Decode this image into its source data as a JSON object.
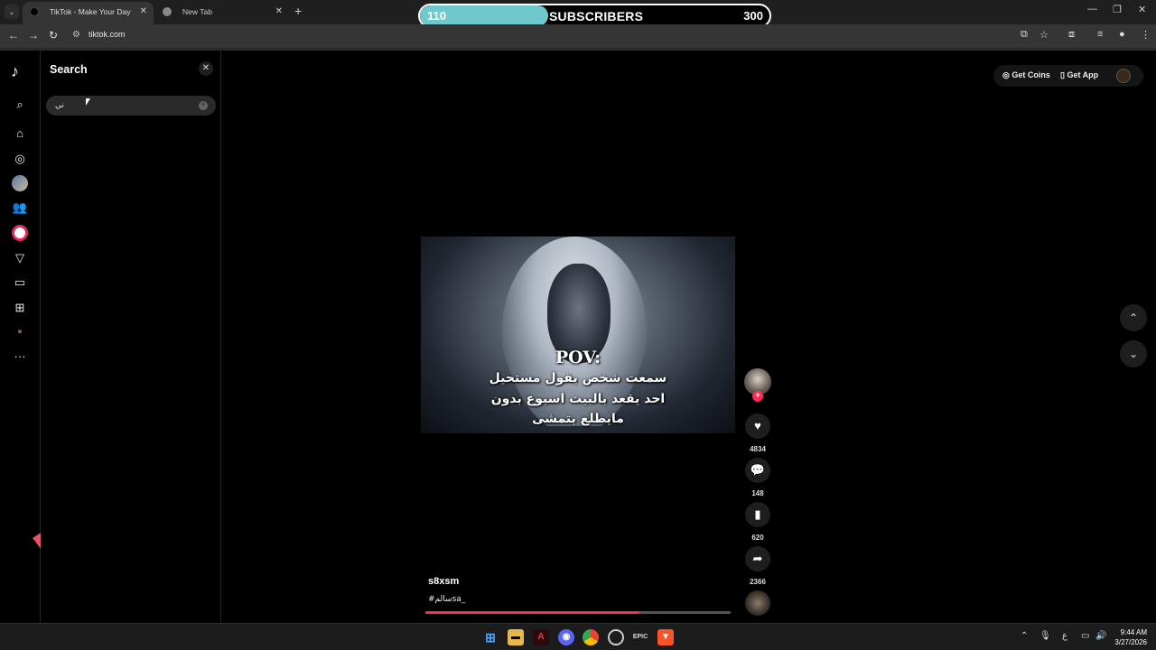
{
  "browser": {
    "tabs": [
      {
        "title": "TikTok - Make Your Day",
        "active": true
      },
      {
        "title": "New Tab",
        "active": false
      }
    ],
    "url": "tiktok.com"
  },
  "overlay": {
    "current": "110",
    "label": "SUBSCRIBERS",
    "goal": "300",
    "progress_fraction": 0.367,
    "color": "#6fc9cc"
  },
  "search_panel": {
    "title": "Search",
    "input_value": "ني"
  },
  "top_actions": {
    "get_coins": "Get Coins",
    "get_app": "Get App"
  },
  "video": {
    "pov": "POV:",
    "caption_lines": [
      "سمعت شخص يقول مستحيل",
      "احد يقعد بالبيت اسبوع بدون",
      "مايطلع يتمشى"
    ],
    "author": "s8xsm",
    "hashtag": "#سالمsa_",
    "progress_fraction": 0.7
  },
  "stats": {
    "likes": "4834",
    "comments": "148",
    "saves": "620",
    "shares": "2366"
  },
  "taskbar": {
    "time": "9:44 AM",
    "date": "3/27/2026",
    "lang": "ع"
  },
  "colors": {
    "accent": "#fe2c55",
    "panel": "#000000"
  }
}
